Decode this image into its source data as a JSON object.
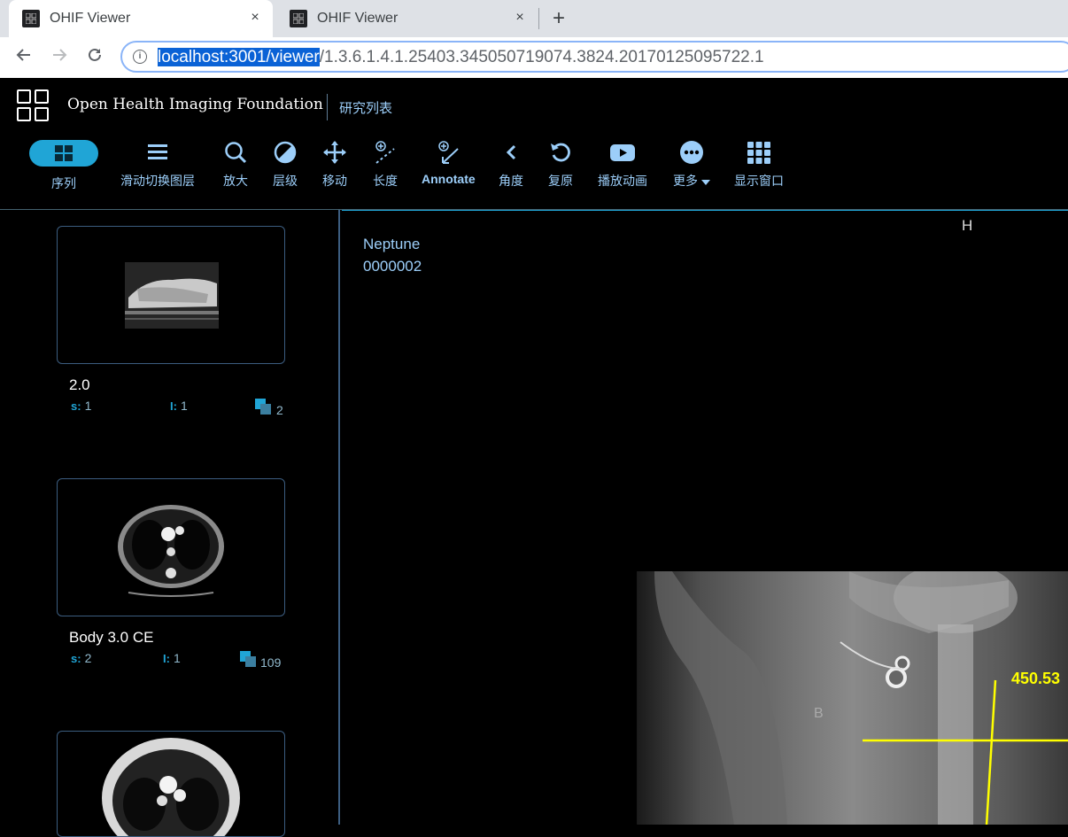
{
  "browser": {
    "tabs": [
      {
        "title": "OHIF Viewer",
        "close": "×"
      },
      {
        "title": "OHIF Viewer",
        "close": "×"
      }
    ],
    "new_tab": "+",
    "url_selected": "localhost:3001/viewer",
    "url_rest": "/1.3.6.1.4.1.25403.345050719074.3824.20170125095722.1",
    "info": "i"
  },
  "header": {
    "brand": "Open Health Imaging Foundation",
    "study_list": "研究列表"
  },
  "toolbar": {
    "series": "序列",
    "stack_scroll": "滑动切换图层",
    "zoom": "放大",
    "levels": "层级",
    "pan": "移动",
    "length": "长度",
    "annotate": "Annotate",
    "angle": "角度",
    "reset": "复原",
    "cine": "播放动画",
    "more": "更多",
    "layout": "显示窗口"
  },
  "series_list": [
    {
      "description": "2.0",
      "series_number": "1",
      "instance_number": "1",
      "image_count": "2",
      "s_label": "s:",
      "i_label": "I:"
    },
    {
      "description": "Body 3.0 CE",
      "series_number": "2",
      "instance_number": "1",
      "image_count": "109",
      "s_label": "s:",
      "i_label": "I:"
    }
  ],
  "viewport": {
    "patient_name": "Neptune",
    "patient_id": "0000002",
    "orientation_top": "H",
    "measurement": "450.53"
  },
  "colors": {
    "accent": "#20a5d6",
    "toolbar_text": "#9ccef9",
    "measurement": "#ffff00"
  }
}
